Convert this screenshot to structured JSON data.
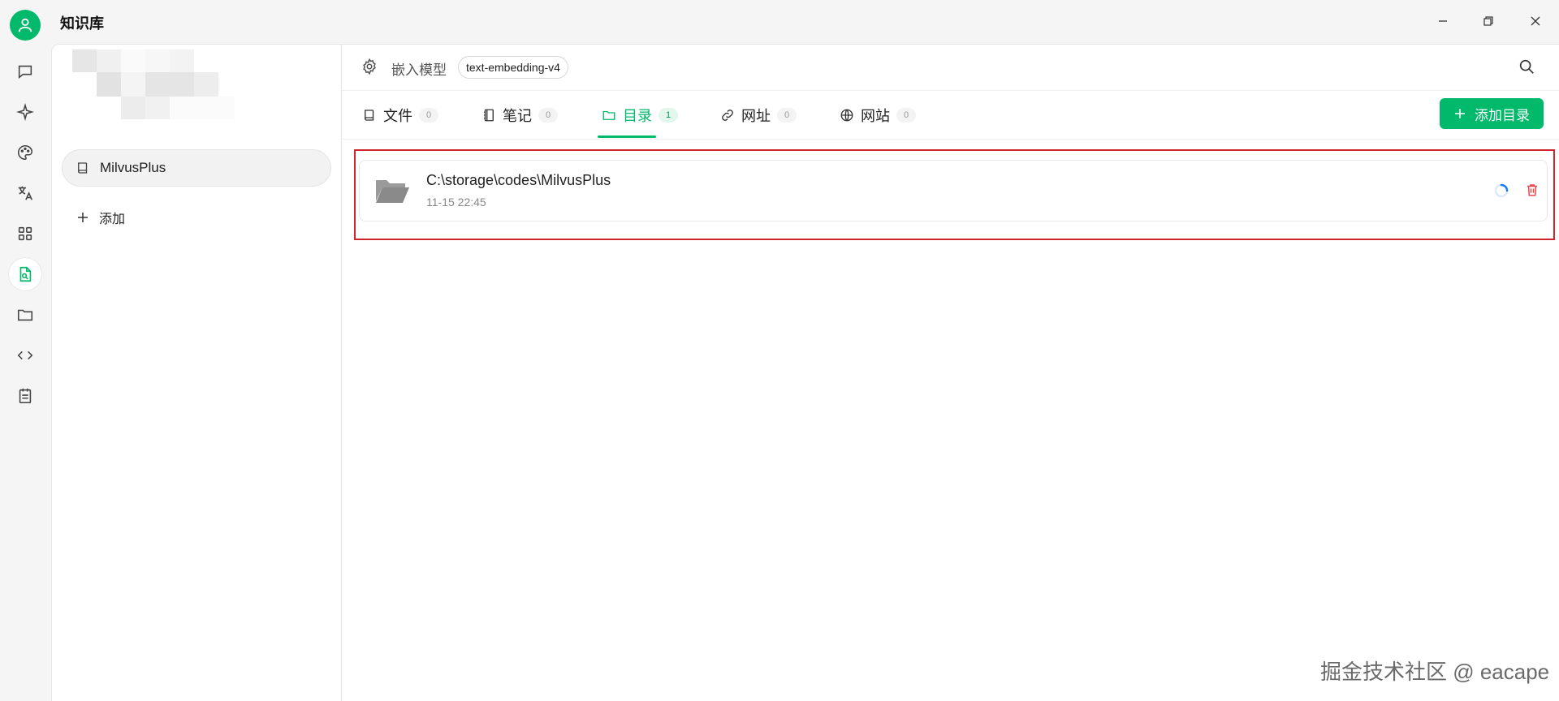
{
  "window": {
    "title": "知识库"
  },
  "rail": {
    "items": [
      {
        "name": "chat-icon"
      },
      {
        "name": "sparkle-icon"
      },
      {
        "name": "palette-icon"
      },
      {
        "name": "translate-icon"
      },
      {
        "name": "apps-grid-icon"
      },
      {
        "name": "knowledge-base-icon",
        "active": true
      },
      {
        "name": "folder-icon"
      },
      {
        "name": "code-icon"
      },
      {
        "name": "notepad-icon"
      }
    ]
  },
  "kb_panel": {
    "items": [
      {
        "label": "MilvusPlus"
      }
    ],
    "add_label": "添加"
  },
  "main": {
    "toolbar": {
      "embed_label": "嵌入模型",
      "model": "text-embedding-v4"
    },
    "tabs": [
      {
        "label": "文件",
        "count": "0"
      },
      {
        "label": "笔记",
        "count": "0"
      },
      {
        "label": "目录",
        "count": "1",
        "active": true
      },
      {
        "label": "网址",
        "count": "0"
      },
      {
        "label": "网站",
        "count": "0"
      }
    ],
    "add_button": "添加目录",
    "directories": [
      {
        "path": "C:\\storage\\codes\\MilvusPlus",
        "time": "11-15 22:45",
        "status": "processing"
      }
    ]
  },
  "watermark": "掘金技术社区 @ eacape",
  "colors": {
    "accent": "#00b96b",
    "danger": "#e5484d",
    "highlight": "#d0242b"
  }
}
